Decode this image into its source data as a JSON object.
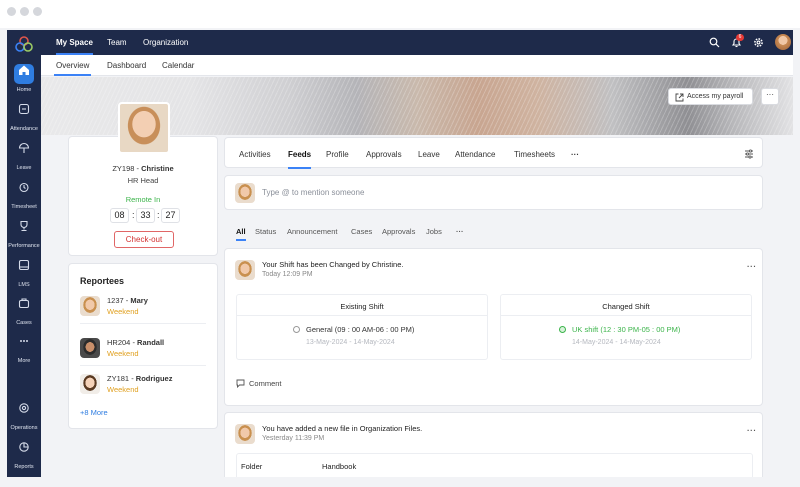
{
  "sidebar": {
    "items": [
      {
        "label": "Home",
        "icon": "home-icon"
      },
      {
        "label": "Attendance",
        "icon": "attendance-icon"
      },
      {
        "label": "Leave",
        "icon": "leave-icon"
      },
      {
        "label": "Timesheet",
        "icon": "timesheet-icon"
      },
      {
        "label": "Performance",
        "icon": "trophy-icon"
      },
      {
        "label": "LMS",
        "icon": "lms-icon"
      },
      {
        "label": "Cases",
        "icon": "cases-icon"
      },
      {
        "label": "More",
        "icon": "more-icon"
      },
      {
        "label": "Operations",
        "icon": "operations-icon"
      },
      {
        "label": "Reports",
        "icon": "reports-icon"
      }
    ]
  },
  "topbar": {
    "nav": [
      "My Space",
      "Team",
      "Organization"
    ],
    "notification_count": "6"
  },
  "subnav": {
    "tabs": [
      "Overview",
      "Dashboard",
      "Calendar"
    ]
  },
  "banner": {
    "payroll_button": "Access my payroll",
    "more_button": "···"
  },
  "profile": {
    "id": "ZY198",
    "separator": " - ",
    "name": "Christine",
    "role": "HR Head",
    "status": "Remote In",
    "time": {
      "hh": "08",
      "mm": "33",
      "ss": "27"
    },
    "time_sep": ":",
    "checkout_label": "Check-out"
  },
  "reportees": {
    "title": "Reportees",
    "items": [
      {
        "id": "1237",
        "name": "Mary",
        "status": "Weekend"
      },
      {
        "id": "HR204",
        "name": "Randall",
        "status": "Weekend"
      },
      {
        "id": "ZY181",
        "name": "Rodriguez",
        "status": "Weekend"
      }
    ],
    "more_link": "+8 More"
  },
  "main_tabs": [
    "Activities",
    "Feeds",
    "Profile",
    "Approvals",
    "Leave",
    "Attendance",
    "Timesheets",
    "···"
  ],
  "composer": {
    "placeholder": "Type @ to mention someone"
  },
  "feed_filters": [
    "All",
    "Status",
    "Announcement",
    "Cases",
    "Approvals",
    "Jobs",
    "···"
  ],
  "feed": [
    {
      "title": "Your Shift has been Changed by Christine.",
      "time": "Today 12:09 PM",
      "existing": {
        "header": "Existing Shift",
        "shift": "General (09 : 00 AM-06 : 00 PM)",
        "dates": "13-May-2024 - 14-May-2024"
      },
      "changed": {
        "header": "Changed Shift",
        "shift": "UK shift (12 : 30 PM-05 : 00 PM)",
        "dates": "14-May-2024 - 14-May-2024"
      },
      "comment_label": "Comment",
      "menu": "···"
    },
    {
      "title": "You have added a new file in Organization Files.",
      "time": "Yesterday 11:39 PM",
      "table": {
        "col1": "Folder",
        "col2": "Handbook"
      },
      "menu": "···"
    }
  ],
  "colors": {
    "sidebar": "#1e2a4a",
    "accent": "#3b82f6",
    "green": "#3bb44a",
    "weekend": "#e0a020",
    "danger": "#d32f2f"
  }
}
